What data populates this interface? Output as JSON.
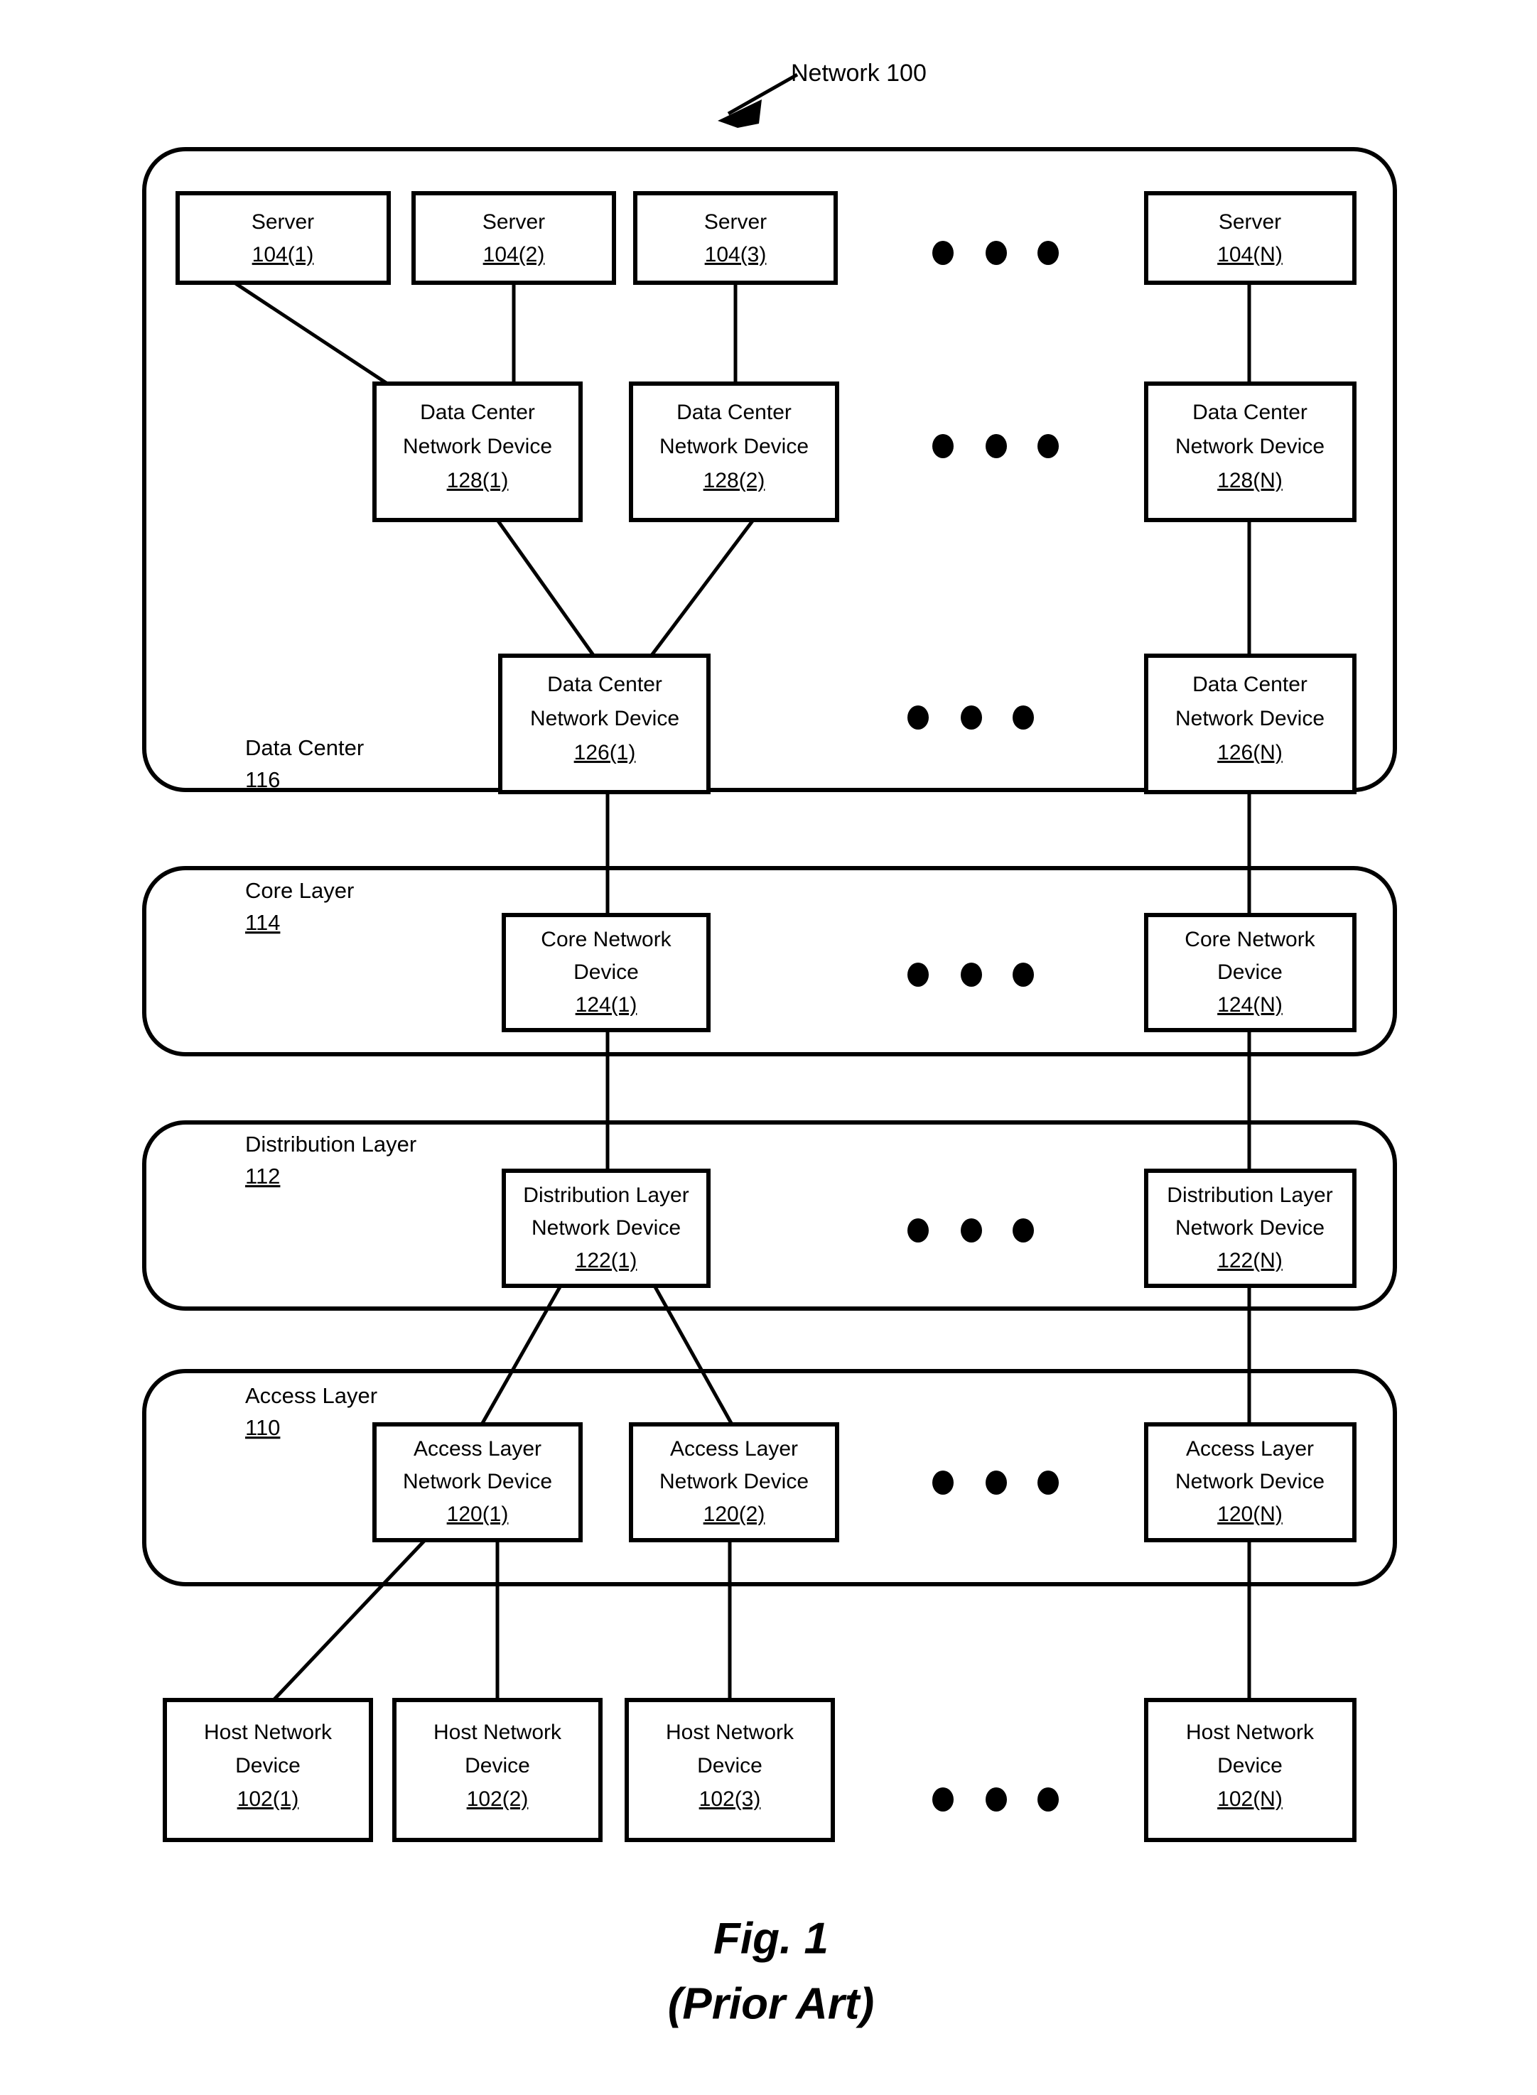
{
  "figure": {
    "callout": "Network 100",
    "caption_line1": "Fig. 1",
    "caption_line2": "(Prior Art)",
    "ink_color": "#000000",
    "background_color": "#ffffff"
  },
  "groups": {
    "data_center": {
      "label": "Data Center",
      "ref": "116"
    },
    "core_layer": {
      "label": "Core Layer",
      "ref": "114"
    },
    "distribution_layer": {
      "label": "Distribution Layer",
      "ref": "112"
    },
    "access_layer": {
      "label": "Access Layer",
      "ref": "110"
    }
  },
  "rows": {
    "servers": [
      {
        "line1": "Server",
        "ref": "104(1)"
      },
      {
        "line1": "Server",
        "ref": "104(2)"
      },
      {
        "line1": "Server",
        "ref": "104(3)"
      },
      {
        "line1": "Server",
        "ref": "104(N)"
      }
    ],
    "dc_devices_128": [
      {
        "line1": "Data Center",
        "line2": "Network Device",
        "ref": "128(1)"
      },
      {
        "line1": "Data Center",
        "line2": "Network Device",
        "ref": "128(2)"
      },
      {
        "line1": "Data Center",
        "line2": "Network Device",
        "ref": "128(N)"
      }
    ],
    "dc_devices_126": [
      {
        "line1": "Data Center",
        "line2": "Network Device",
        "ref": "126(1)"
      },
      {
        "line1": "Data Center",
        "line2": "Network Device",
        "ref": "126(N)"
      }
    ],
    "core_devices_124": [
      {
        "line1": "Core Network",
        "line2": "Device",
        "ref": "124(1)"
      },
      {
        "line1": "Core Network",
        "line2": "Device",
        "ref": "124(N)"
      }
    ],
    "distribution_devices_122": [
      {
        "line1": "Distribution Layer",
        "line2": "Network Device",
        "ref": "122(1)"
      },
      {
        "line1": "Distribution Layer",
        "line2": "Network Device",
        "ref": "122(N)"
      }
    ],
    "access_devices_120": [
      {
        "line1": "Access Layer",
        "line2": "Network Device",
        "ref": "120(1)"
      },
      {
        "line1": "Access Layer",
        "line2": "Network Device",
        "ref": "120(2)"
      },
      {
        "line1": "Access Layer",
        "line2": "Network Device",
        "ref": "120(N)"
      }
    ],
    "hosts_102": [
      {
        "line1": "Host Network",
        "line2": "Device",
        "ref": "102(1)"
      },
      {
        "line1": "Host Network",
        "line2": "Device",
        "ref": "102(2)"
      },
      {
        "line1": "Host Network",
        "line2": "Device",
        "ref": "102(3)"
      },
      {
        "line1": "Host Network",
        "line2": "Device",
        "ref": "102(N)"
      }
    ]
  },
  "ellipses": {
    "glyph": "•",
    "count": 3,
    "rows": [
      "servers",
      "dc_devices_128",
      "dc_devices_126",
      "core_devices_124",
      "distribution_devices_122",
      "access_devices_120",
      "hosts_102"
    ]
  }
}
